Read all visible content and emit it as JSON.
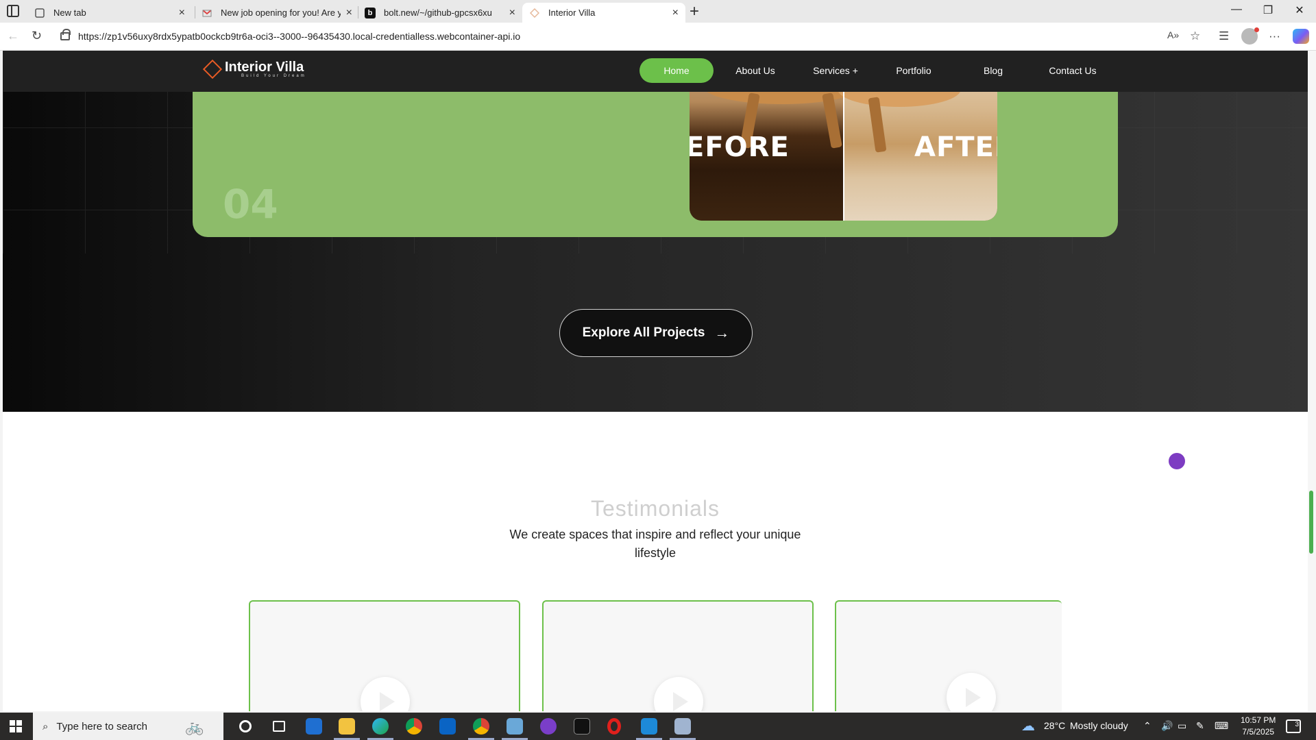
{
  "browser": {
    "tabs": [
      {
        "title": "New tab",
        "icon": "page-icon"
      },
      {
        "title": "New job opening for you! Are you",
        "icon": "gmail-icon"
      },
      {
        "title": "bolt.new/~/github-gpcsx6xu",
        "icon": "bolt-icon"
      },
      {
        "title": "Interior Villa",
        "icon": "interior-villa-icon"
      }
    ],
    "url": "https://zp1v56uxy8rdx5ypatb0ockcb9tr6a-oci3--3000--96435430.local-credentialless.webcontainer-api.io"
  },
  "site": {
    "logo_title": "Interior Villa",
    "logo_tagline": "Build Your Dream",
    "nav": [
      "Home",
      "About Us",
      "Services +",
      "Portfolio",
      "Blog",
      "Contact Us"
    ],
    "active_nav": "Home",
    "accent_color": "#6cc04a",
    "project_card": {
      "number": "04",
      "before_label": "EFORE",
      "after_label": "AFTER",
      "card_color": "#8dbc6a"
    },
    "explore_label": "Explore All Projects",
    "testimonials": {
      "title": "Testimonials",
      "subtitle": "We create spaces that inspire and reflect your unique lifestyle"
    }
  },
  "taskbar": {
    "search_placeholder": "Type here to search",
    "weather_temp": "28°C",
    "weather_text": "Mostly cloudy",
    "time": "10:57 PM",
    "date": "7/5/2025",
    "notification_count": "3"
  }
}
